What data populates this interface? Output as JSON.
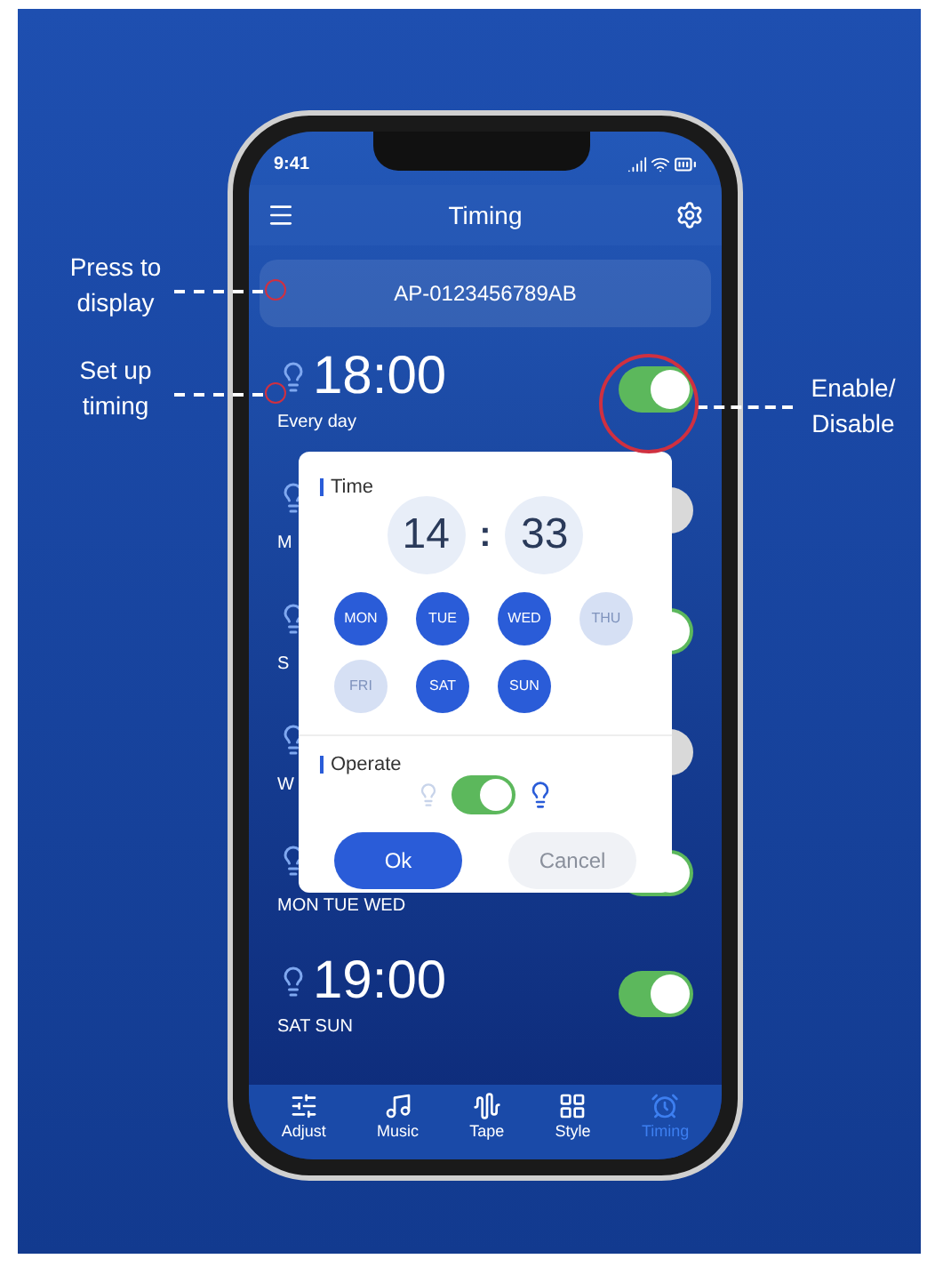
{
  "annotations": [
    {
      "text": "Press to display"
    },
    {
      "text": "Set up timing"
    },
    {
      "text": "Enable/ Disable"
    }
  ],
  "status_bar": {
    "time": "9:41"
  },
  "header": {
    "title": "Timing"
  },
  "device": {
    "id": "AP-0123456789AB"
  },
  "timers": [
    {
      "time": "18:00",
      "days": "Every day",
      "on": true
    },
    {
      "days": "M",
      "on": false
    },
    {
      "days": "S",
      "on": true
    },
    {
      "days": "W",
      "on": false
    },
    {
      "days": "MON TUE WED",
      "on": true
    },
    {
      "time": "19:00",
      "days": "SAT SUN",
      "on": true
    }
  ],
  "dialog": {
    "time_label": "Time",
    "hour": "14",
    "separator": ":",
    "minute": "33",
    "days": [
      {
        "label": "MON",
        "selected": true
      },
      {
        "label": "TUE",
        "selected": true
      },
      {
        "label": "WED",
        "selected": true
      },
      {
        "label": "THU",
        "selected": false
      },
      {
        "label": "FRI",
        "selected": false
      },
      {
        "label": "SAT",
        "selected": true
      },
      {
        "label": "SUN",
        "selected": true
      }
    ],
    "operate_label": "Operate",
    "operate_on": true,
    "ok": "Ok",
    "cancel": "Cancel"
  },
  "tabs": [
    {
      "label": "Adjust",
      "selected": false
    },
    {
      "label": "Music",
      "selected": false
    },
    {
      "label": "Tape",
      "selected": false
    },
    {
      "label": "Style",
      "selected": false
    },
    {
      "label": "Timing",
      "selected": true
    }
  ]
}
